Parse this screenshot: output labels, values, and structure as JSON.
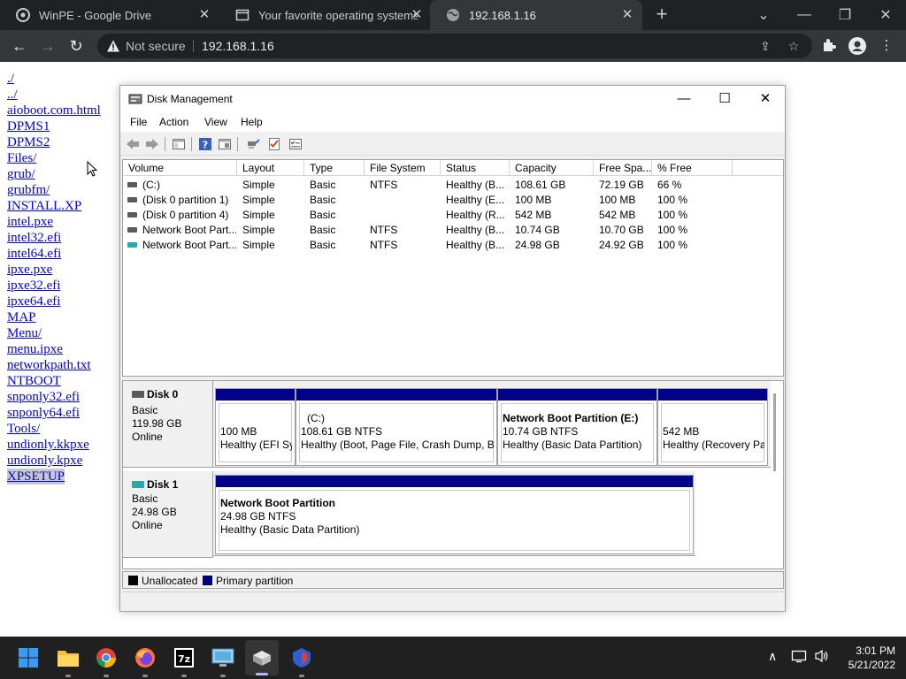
{
  "browser": {
    "tabs": [
      {
        "title": "WinPE - Google Drive"
      },
      {
        "title": "Your favorite operating systems i"
      },
      {
        "title": "192.168.1.16"
      }
    ],
    "security_label": "Not secure",
    "url": "192.168.1.16"
  },
  "listing": [
    "./",
    "../",
    "aioboot.com.html",
    "DPMS1",
    "DPMS2",
    "Files/",
    "grub/",
    "grubfm/",
    "INSTALL.XP",
    "intel.pxe",
    "intel32.efi",
    "intel64.efi",
    "ipxe.pxe",
    "ipxe32.efi",
    "ipxe64.efi",
    "MAP",
    "Menu/",
    "menu.ipxe",
    "networkpath.txt",
    "NTBOOT",
    "snponly32.efi",
    "snponly64.efi",
    "Tools/",
    "undionly.kkpxe",
    "undionly.kpxe",
    "XPSETUP"
  ],
  "dm": {
    "title": "Disk Management",
    "menu": [
      "File",
      "Action",
      "View",
      "Help"
    ],
    "columns": [
      "Volume",
      "Layout",
      "Type",
      "File System",
      "Status",
      "Capacity",
      "Free Spa...",
      "% Free"
    ],
    "volumes": [
      {
        "volume": "(C:)",
        "layout": "Simple",
        "type": "Basic",
        "fs": "NTFS",
        "status": "Healthy (B...",
        "capacity": "108.61 GB",
        "free": "72.19 GB",
        "pct": "66 %",
        "icon_color": "#5a5a5a"
      },
      {
        "volume": "(Disk 0 partition 1)",
        "layout": "Simple",
        "type": "Basic",
        "fs": "",
        "status": "Healthy (E...",
        "capacity": "100 MB",
        "free": "100 MB",
        "pct": "100 %",
        "icon_color": "#5a5a5a"
      },
      {
        "volume": "(Disk 0 partition 4)",
        "layout": "Simple",
        "type": "Basic",
        "fs": "",
        "status": "Healthy (R...",
        "capacity": "542 MB",
        "free": "542 MB",
        "pct": "100 %",
        "icon_color": "#5a5a5a"
      },
      {
        "volume": "Network Boot Part...",
        "layout": "Simple",
        "type": "Basic",
        "fs": "NTFS",
        "status": "Healthy (B...",
        "capacity": "10.74 GB",
        "free": "10.70 GB",
        "pct": "100 %",
        "icon_color": "#5a5a5a"
      },
      {
        "volume": "Network Boot Part...",
        "layout": "Simple",
        "type": "Basic",
        "fs": "NTFS",
        "status": "Healthy (B...",
        "capacity": "24.98 GB",
        "free": "24.92 GB",
        "pct": "100 %",
        "icon_color": "#2aa7a7"
      }
    ],
    "disks": [
      {
        "name": "Disk 0",
        "type": "Basic",
        "size": "119.98 GB",
        "state": "Online",
        "icon_color": "#5a5a5a",
        "partitions": [
          {
            "title": "",
            "line1": "100 MB",
            "line2": "Healthy (EFI Sy"
          },
          {
            "title": "(C:)",
            "line1": "108.61 GB NTFS",
            "line2": "Healthy (Boot, Page File, Crash Dump, B"
          },
          {
            "title": "Network Boot Partition  (E:)",
            "line1": "10.74 GB NTFS",
            "line2": "Healthy (Basic Data Partition)"
          },
          {
            "title": "",
            "line1": "542 MB",
            "line2": "Healthy (Recovery Pa"
          }
        ]
      },
      {
        "name": "Disk 1",
        "type": "Basic",
        "size": "24.98 GB",
        "state": "Online",
        "icon_color": "#2aa7a7",
        "partitions": [
          {
            "title": "Network Boot Partition",
            "line1": "24.98 GB NTFS",
            "line2": "Healthy (Basic Data Partition)"
          }
        ]
      }
    ],
    "legend": [
      {
        "label": "Unallocated",
        "color": "#000000"
      },
      {
        "label": "Primary partition",
        "color": "#00008b"
      }
    ]
  },
  "clock": {
    "time": "3:01 PM",
    "date": "5/21/2022"
  }
}
